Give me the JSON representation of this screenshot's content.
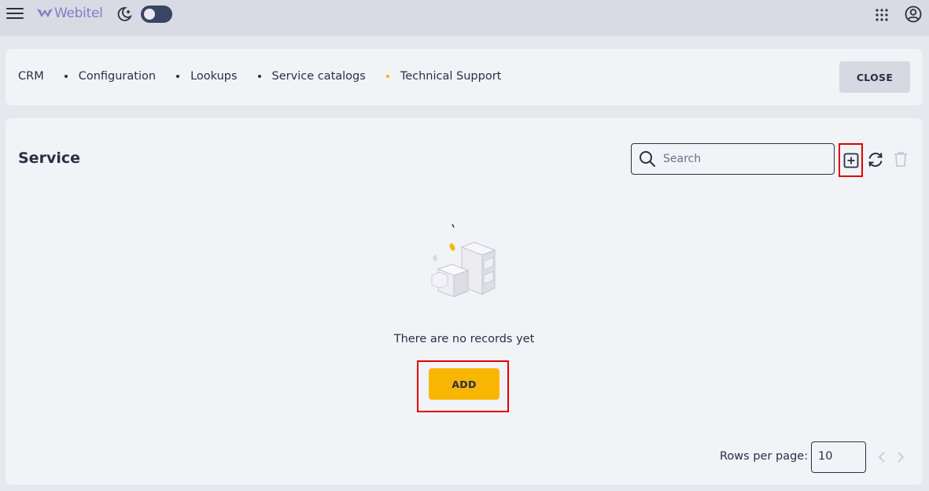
{
  "app": {
    "name": "Webitel",
    "brand_color": "#8a79c6",
    "accent_color": "#f9b600",
    "theme_toggle": "off"
  },
  "icons": {
    "menu": "hamburger-icon",
    "theme": "moon-icon",
    "apps": "grid-icon",
    "account": "user-circle-icon",
    "search": "search-icon",
    "add": "plus-square-icon",
    "refresh": "refresh-icon",
    "delete": "trash-icon",
    "prev": "chevron-left-icon",
    "next": "chevron-right-icon"
  },
  "breadcrumb": {
    "items": [
      "CRM",
      "Configuration",
      "Lookups",
      "Service catalogs",
      "Technical Support"
    ]
  },
  "header": {
    "close_label": "CLOSE"
  },
  "main": {
    "title": "Service",
    "search_placeholder": "Search",
    "empty_text": "There are no records yet",
    "add_label": "ADD"
  },
  "pagination": {
    "rows_label": "Rows per page:",
    "rows_value": "10"
  }
}
